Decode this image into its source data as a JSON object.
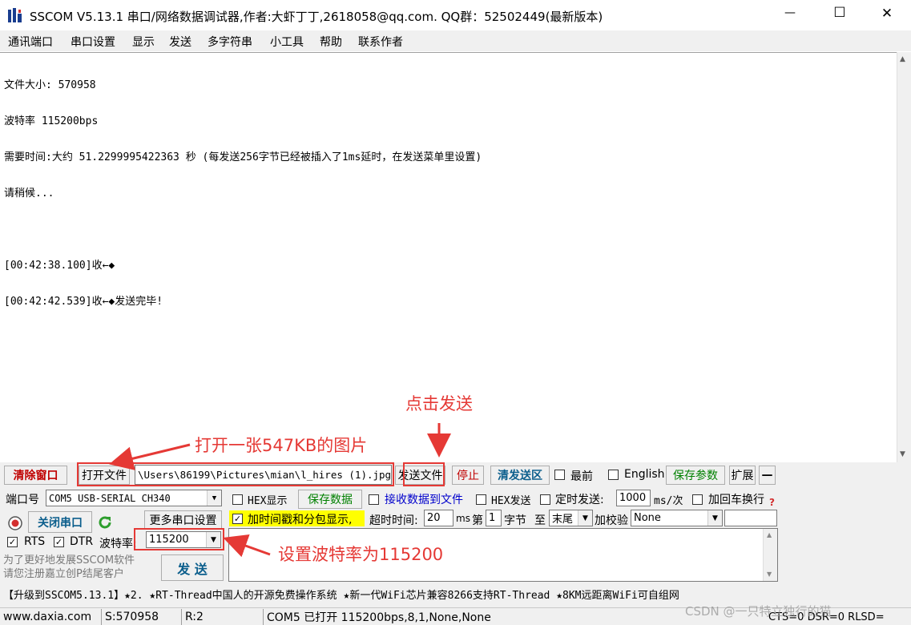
{
  "window": {
    "title": "SSCOM V5.13.1 串口/网络数据调试器,作者:大虾丁丁,2618058@qq.com. QQ群：52502449(最新版本)",
    "minimize_glyph": "—",
    "maximize_glyph": "☐",
    "close_glyph": "✕"
  },
  "menu": [
    "通讯端口",
    "串口设置",
    "显示",
    "发送",
    "多字符串",
    "小工具",
    "帮助",
    "联系作者"
  ],
  "receive": {
    "lines": [
      "文件大小: 570958",
      "波特率 115200bps",
      "需要时间:大约 51.2299995422363 秒 (每发送256字节已经被插入了1ms延时，在发送菜单里设置)",
      "请稍候...",
      "",
      "[00:42:38.100]收←◆",
      "[00:42:42.539]收←◆发送完毕!"
    ]
  },
  "file_row": {
    "clear_button": "清除窗口",
    "open_file_button": "打开文件",
    "file_path": "\\Users\\86199\\Pictures\\mian\\l_hires (1).jpg",
    "send_file_button": "发送文件",
    "stop_button": "停止",
    "clear_send_button": "清发送区",
    "topmost_label": "最前",
    "english_label": "English",
    "save_params_button": "保存参数",
    "expand_button": "扩展",
    "collapse_button": "—"
  },
  "port": {
    "port_label": "端口号",
    "port_value": "COM5 USB-SERIAL CH340",
    "close_port_button": "关闭串口",
    "more_settings_button": "更多串口设置",
    "rts_label": "RTS",
    "dtr_label": "DTR",
    "baud_label": "波特率:",
    "baud_value": "115200",
    "promo_line1": "为了更好地发展SSCOM软件",
    "promo_line2": "请您注册嘉立创P结尾客户"
  },
  "options": {
    "hex_display_label": "HEX显示",
    "save_data_button": "保存数据",
    "recv_to_file_label": "接收数据到文件",
    "hex_send_label": "HEX发送",
    "timed_send_label": "定时发送:",
    "timed_interval": "1000",
    "interval_unit": "ms/次",
    "append_newline_label": "加回车换行",
    "timestamp_label": "加时间戳和分包显示,",
    "timeout_label": "超时时间:",
    "timeout_value": "20",
    "timeout_unit": "ms",
    "byte_prefix": "第",
    "byte_index": "1",
    "byte_suffix": "字节",
    "to_label": "至",
    "to_value": "末尾",
    "checksum_label": "加校验",
    "checksum_value": "None",
    "send_button": "发 送",
    "help_glyph": "?"
  },
  "promo_bar": "【升级到SSCOM5.13.1】★2. ★RT-Thread中国人的开源免费操作系统 ★新一代WiFi芯片兼容8266支持RT-Thread ★8KM远距离WiFi可自组网",
  "status": {
    "site": "www.daxia.com",
    "sent": "S:570958",
    "received": "R:2",
    "port_state": "COM5 已打开  115200bps,8,1,None,None",
    "lines": "CTS=0 DSR=0 RLSD=",
    "watermark": "CSDN @一只特立独行的猫"
  },
  "annotations": {
    "click_send": "点击发送",
    "open_image": "打开一张547KB的图片",
    "set_baud": "设置波特率为115200"
  },
  "colors": {
    "annotation": "#e53935",
    "highlight_yellow": "#ffff00",
    "green_button_text": "#008000",
    "red_button_text": "#c00000"
  }
}
